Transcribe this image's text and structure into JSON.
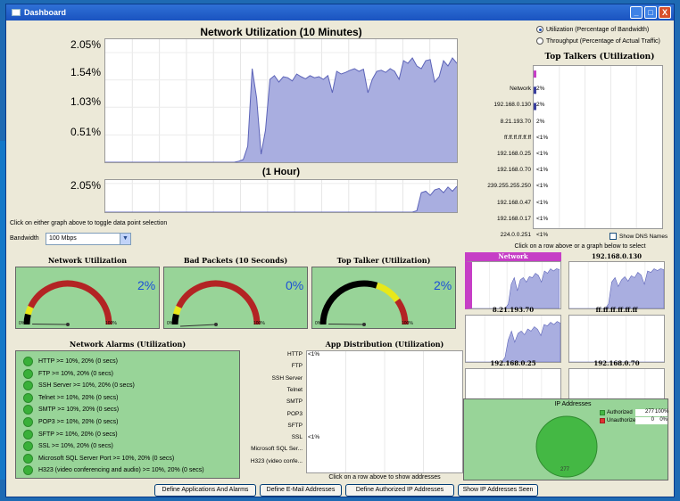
{
  "window": {
    "title": "Dashboard",
    "minimize": "_",
    "maximize": "□",
    "close": "X"
  },
  "colors": {
    "area_fill": "#a9aee0",
    "area_line": "#5c63b8",
    "panel_green": "#98d498",
    "gauge_red": "#b32424",
    "gauge_black": "#000000",
    "gauge_yellow": "#e8e81a",
    "gauge_value": "#1b4fd8",
    "alarm_green": "#39b039",
    "unauthorized_red": "#e03030"
  },
  "util_chart": {
    "title": "Network Utilization (10 Minutes)",
    "y_labels": [
      "2.05%",
      "1.54%",
      "1.03%",
      "0.51%"
    ],
    "hour_title": "(1 Hour)",
    "hour_y_label": "2.05%",
    "hint": "Click on either graph above to toggle data point selection"
  },
  "chart_data": [
    {
      "type": "area",
      "title": "Network Utilization (10 Minutes)",
      "ylim": [
        0,
        2.3
      ],
      "yticks": [
        0.51,
        1.03,
        1.54,
        2.05
      ],
      "series": [
        {
          "values": [
            0,
            0,
            0,
            0,
            0,
            0,
            0,
            0,
            0,
            0,
            0,
            0,
            0,
            0,
            0,
            0,
            0,
            0,
            0,
            0,
            0,
            0,
            0,
            0,
            0,
            0,
            0,
            0,
            0,
            0,
            0.02,
            0.05,
            0.3,
            1.75,
            1.2,
            0.15,
            0.6,
            1.55,
            1.62,
            1.5,
            1.6,
            1.58,
            1.52,
            1.65,
            1.6,
            1.56,
            1.62,
            1.58,
            1.6,
            1.55,
            1.62,
            1.3,
            1.7,
            1.65,
            1.68,
            1.72,
            1.75,
            1.7,
            1.74,
            1.3,
            1.55,
            1.7,
            1.72,
            1.68,
            1.75,
            1.7,
            1.55,
            1.9,
            1.85,
            1.95,
            1.8,
            1.75,
            1.9,
            1.92,
            1.5,
            1.6,
            1.9,
            1.8,
            1.95,
            1.85
          ]
        }
      ]
    },
    {
      "type": "area",
      "title": "(1 Hour)",
      "ylim": [
        0,
        2.3
      ],
      "yticks": [
        2.05
      ],
      "series": [
        {
          "values": [
            0,
            0,
            0,
            0,
            0,
            0,
            0,
            0,
            0,
            0,
            0,
            0,
            0,
            0,
            0,
            0,
            0,
            0,
            0,
            0,
            0,
            0,
            0,
            0,
            0,
            0,
            0,
            0,
            0,
            0,
            0,
            0,
            0,
            0,
            0,
            0,
            0,
            0,
            0,
            0,
            0,
            0,
            0,
            0,
            0,
            0,
            0,
            0,
            0,
            0,
            0,
            0,
            0,
            0,
            0,
            0,
            0,
            0,
            0,
            0,
            0,
            0,
            0,
            0,
            0,
            0,
            0,
            0,
            0,
            0,
            0.1,
            1.4,
            1.5,
            1.2,
            1.6,
            1.7,
            1.4,
            1.8,
            1.5,
            1.85
          ]
        }
      ]
    },
    {
      "type": "bar",
      "title": "Top Talkers (Utilization)",
      "categories": [
        "Network",
        "192.168.0.130",
        "8.21.193.70",
        "ff.ff.ff.ff.ff.ff",
        "192.168.0.25",
        "192.168.0.70",
        "239.255.255.250",
        "192.168.0.47",
        "192.168.0.17",
        "224.0.0.251"
      ],
      "values": [
        2,
        2,
        2,
        0.5,
        0.5,
        0.5,
        0.5,
        0.5,
        0.5,
        0.5
      ],
      "value_labels": [
        "2%",
        "2%",
        "2%",
        "<1%",
        "<1%",
        "<1%",
        "<1%",
        "<1%",
        "<1%",
        "<1%"
      ]
    },
    {
      "type": "bar",
      "title": "App Distribution (Utilization)",
      "categories": [
        "HTTP",
        "FTP",
        "SSH Server",
        "Telnet",
        "SMTP",
        "POP3",
        "SFTP",
        "SSL",
        "Microsoft SQL Ser...",
        "H323 (video confe..."
      ],
      "value_labels": [
        "<1%",
        "",
        "",
        "",
        "",
        "",
        "",
        "<1%",
        "",
        ""
      ]
    },
    {
      "type": "pie",
      "title": "IP Addresses",
      "categories": [
        "Authorized",
        "Unauthorized"
      ],
      "values": [
        277,
        0
      ],
      "percent_labels": [
        "100%",
        "0%"
      ],
      "slice_label": "277"
    }
  ],
  "bandwidth": {
    "label": "Bandwidth",
    "value": "100 Mbps"
  },
  "radio": [
    {
      "label": "Utilization (Percentage of Bandwidth)",
      "selected": true
    },
    {
      "label": "Throughput (Percentage of Actual Traffic)",
      "selected": false
    }
  ],
  "top_talkers": {
    "title": "Top Talkers (Utilization)",
    "show_dns": "Show DNS Names",
    "hint": "Click on a row above or a graph below to select"
  },
  "mini_graphs": [
    {
      "title": "Network",
      "highlight": true,
      "values": [
        0,
        0,
        0,
        0,
        0,
        0,
        0,
        0,
        0,
        0,
        0,
        0,
        0.1,
        0.55,
        0.7,
        0.4,
        0.65,
        0.7,
        0.6,
        0.72,
        0.7,
        0.8,
        0.75,
        0.6,
        0.85,
        0.8,
        0.9,
        0.85,
        0.9,
        0.88
      ]
    },
    {
      "title": "192.168.0.130",
      "highlight": false,
      "values": [
        0,
        0,
        0,
        0,
        0,
        0,
        0,
        0,
        0,
        0,
        0,
        0,
        0.1,
        0.6,
        0.7,
        0.5,
        0.65,
        0.72,
        0.62,
        0.74,
        0.7,
        0.82,
        0.76,
        0.55,
        0.85,
        0.82,
        0.9,
        0.86,
        0.9,
        0.88
      ]
    },
    {
      "title": "8.21.193.70",
      "highlight": false,
      "values": [
        0,
        0,
        0,
        0,
        0,
        0,
        0,
        0,
        0,
        0,
        0,
        0,
        0.1,
        0.5,
        0.7,
        0.45,
        0.65,
        0.7,
        0.62,
        0.75,
        0.7,
        0.8,
        0.74,
        0.6,
        0.85,
        0.82,
        0.9,
        0.85,
        0.92,
        0.88
      ]
    },
    {
      "title": "ff.ff.ff.ff.ff.ff",
      "highlight": false,
      "values": [
        0,
        0,
        0,
        0,
        0,
        0,
        0,
        0,
        0,
        0,
        0,
        0,
        0,
        0,
        0,
        0,
        0,
        0,
        0,
        0,
        0,
        0,
        0,
        0,
        0,
        0,
        0,
        0,
        0,
        0
      ]
    },
    {
      "title": "192.168.0.25",
      "highlight": false,
      "values": [
        0,
        0,
        0,
        0,
        0,
        0,
        0,
        0,
        0,
        0,
        0,
        0,
        0,
        0,
        0,
        0,
        0,
        0,
        0,
        0,
        0,
        0,
        0,
        0,
        0,
        0,
        0,
        0,
        0,
        0
      ]
    },
    {
      "title": "192.168.0.70",
      "highlight": false,
      "values": [
        0,
        0,
        0,
        0,
        0,
        0,
        0,
        0,
        0,
        0,
        0,
        0,
        0,
        0,
        0,
        0,
        0,
        0,
        0,
        0,
        0,
        0,
        0,
        0,
        0,
        0,
        0,
        0,
        0,
        0
      ]
    }
  ],
  "gauges": [
    {
      "title": "Network Utilization",
      "value": "2%",
      "fraction": 0.02,
      "min": "0%",
      "max": "100%"
    },
    {
      "title": "Bad Packets (10 Seconds)",
      "value": "0%",
      "fraction": 0.0,
      "min": "0%",
      "max": "100%"
    },
    {
      "title": "Top Talker (Utilization)",
      "value": "2%",
      "fraction": 0.02,
      "min": "0%",
      "max": "100%"
    }
  ],
  "alarms": {
    "title": "Network Alarms (Utilization)",
    "items": [
      "HTTP >= 10%, 20% (0 secs)",
      "FTP >= 10%, 20% (0 secs)",
      "SSH Server >= 10%, 20% (0 secs)",
      "Telnet >= 10%, 20% (0 secs)",
      "SMTP >= 10%, 20% (0 secs)",
      "POP3 >= 10%, 20% (0 secs)",
      "SFTP >= 10%, 20% (0 secs)",
      "SSL >= 10%, 20% (0 secs)",
      "Microsoft SQL Server Port >= 10%, 20% (0 secs)",
      "H323 (video conferencing and audio) >= 10%, 20% (0 secs)"
    ]
  },
  "app_dist": {
    "title": "App Distribution (Utilization)",
    "hint": "Click on a row above to show addresses"
  },
  "ip_panel": {
    "title": "IP Addresses",
    "authorized": {
      "label": "Authorized",
      "count": "277",
      "percent": "100%"
    },
    "unauthorized": {
      "label": "Unauthorized",
      "count": "0",
      "percent": "0%"
    },
    "pie_label": "277"
  },
  "buttons": [
    "Define Applications And Alarms",
    "Define E-Mail Addresses",
    "Define Authorized IP Addresses",
    "Show IP Addresses Seen"
  ]
}
